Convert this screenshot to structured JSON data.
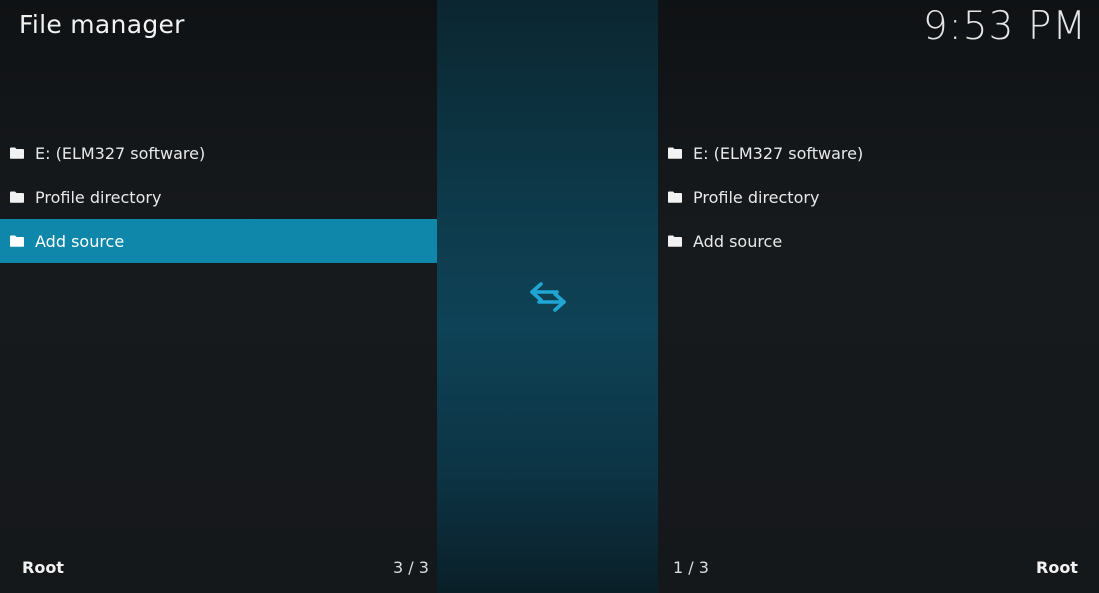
{
  "header": {
    "title": "File manager",
    "clock": "9:53 PM"
  },
  "left_pane": {
    "items": [
      {
        "label": "E: (ELM327 software)",
        "icon": "folder-icon"
      },
      {
        "label": "Profile directory",
        "icon": "folder-icon"
      },
      {
        "label": "Add source",
        "icon": "folder-icon",
        "selected": true
      }
    ],
    "footer_path": "Root",
    "footer_count": "3 / 3"
  },
  "right_pane": {
    "items": [
      {
        "label": "E: (ELM327 software)",
        "icon": "folder-icon"
      },
      {
        "label": "Profile directory",
        "icon": "folder-icon"
      },
      {
        "label": "Add source",
        "icon": "folder-icon"
      }
    ],
    "footer_path": "Root",
    "footer_count": "1 / 3"
  },
  "center": {
    "icon": "swap-arrows-icon"
  },
  "colors": {
    "accent": "#0e87aa",
    "swap_icon": "#1fa6d4",
    "background": "#15181b"
  }
}
